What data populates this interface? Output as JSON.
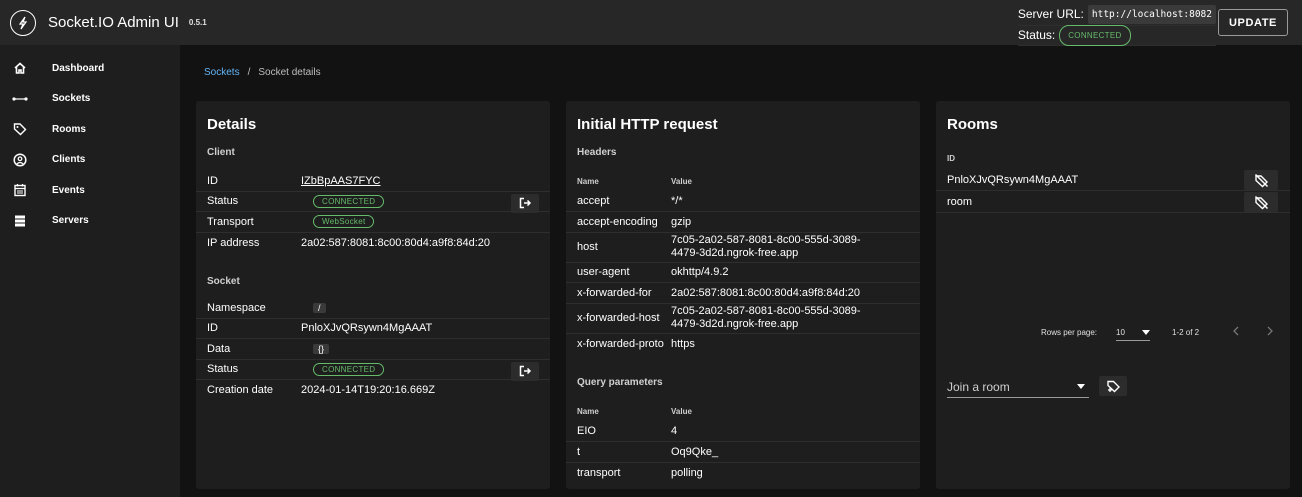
{
  "app": {
    "title": "Socket.IO Admin UI",
    "version": "0.5.1"
  },
  "server": {
    "url_label": "Server URL:",
    "url": "http://localhost:8082",
    "status_label": "Status:",
    "status": "CONNECTED",
    "update_label": "UPDATE"
  },
  "sidebar": {
    "items": [
      {
        "label": "Dashboard",
        "icon": "home-icon"
      },
      {
        "label": "Sockets",
        "icon": "sockets-icon"
      },
      {
        "label": "Rooms",
        "icon": "tag-icon"
      },
      {
        "label": "Clients",
        "icon": "user-circle-icon"
      },
      {
        "label": "Events",
        "icon": "calendar-icon"
      },
      {
        "label": "Servers",
        "icon": "server-icon"
      }
    ]
  },
  "breadcrumb": {
    "link": "Sockets",
    "sep": "/",
    "current": "Socket details"
  },
  "details": {
    "title": "Details",
    "client_section": "Client",
    "client": {
      "id_label": "ID",
      "id": "IZbBpAAS7FYC",
      "status_label": "Status",
      "status": "CONNECTED",
      "transport_label": "Transport",
      "transport": "WebSocket",
      "ip_label": "IP address",
      "ip": "2a02:587:8081:8c00:80d4:a9f8:84d:20"
    },
    "socket_section": "Socket",
    "socket": {
      "namespace_label": "Namespace",
      "namespace": "/",
      "id_label": "ID",
      "id": "PnloXJvQRsywn4MgAAAT",
      "data_label": "Data",
      "data": "{}",
      "status_label": "Status",
      "status": "CONNECTED",
      "creation_label": "Creation date",
      "creation": "2024-01-14T19:20:16.669Z"
    }
  },
  "http": {
    "title": "Initial HTTP request",
    "headers_section": "Headers",
    "name_col": "Name",
    "value_col": "Value",
    "headers": [
      {
        "name": "accept",
        "value": "*/*"
      },
      {
        "name": "accept-encoding",
        "value": "gzip"
      },
      {
        "name": "host",
        "value": "7c05-2a02-587-8081-8c00-555d-3089-4479-3d2d.ngrok-free.app"
      },
      {
        "name": "user-agent",
        "value": "okhttp/4.9.2"
      },
      {
        "name": "x-forwarded-for",
        "value": "2a02:587:8081:8c00:80d4:a9f8:84d:20"
      },
      {
        "name": "x-forwarded-host",
        "value": "7c05-2a02-587-8081-8c00-555d-3089-4479-3d2d.ngrok-free.app"
      },
      {
        "name": "x-forwarded-proto",
        "value": "https"
      }
    ],
    "query_section": "Query parameters",
    "query": [
      {
        "name": "EIO",
        "value": "4"
      },
      {
        "name": "t",
        "value": "Oq9Qke_"
      },
      {
        "name": "transport",
        "value": "polling"
      }
    ]
  },
  "rooms": {
    "title": "Rooms",
    "id_col": "ID",
    "items": [
      "PnloXJvQRsywn4MgAAAT",
      "room"
    ],
    "rows_per_page_label": "Rows per page:",
    "rows_per_page": "10",
    "range": "1-2 of 2",
    "join_placeholder": "Join a room"
  },
  "colors": {
    "accent": "#64b5f6",
    "success": "#66bb6a",
    "card": "#1e1e1e",
    "bg": "#121212"
  }
}
